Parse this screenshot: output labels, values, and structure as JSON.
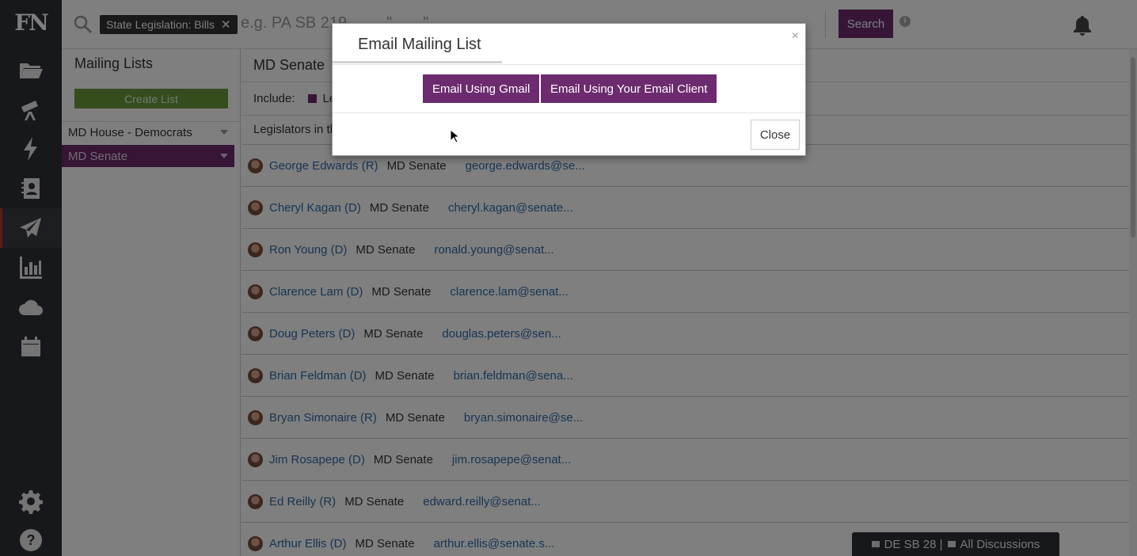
{
  "app": {
    "logo": "FN"
  },
  "rail": {
    "icons": [
      "folder-icon",
      "telescope-icon",
      "lightning-icon",
      "contacts-icon",
      "send-icon",
      "chart-icon",
      "cloud-icon",
      "calendar-icon",
      "gear-icon",
      "help-icon"
    ],
    "active": "send-icon"
  },
  "topbar": {
    "filter_chip": "State Legislation: Bills",
    "search_placeholder": "e.g. PA SB 219 ... ... \"... ...\"",
    "search_button": "Search"
  },
  "lists": {
    "title": "Mailing Lists",
    "create_button": "Create List",
    "items": [
      {
        "label": "MD House - Democrats",
        "selected": false
      },
      {
        "label": "MD Senate",
        "selected": true
      }
    ]
  },
  "main": {
    "header": "MD Senate",
    "include_label": "Include:",
    "include_option": "Le",
    "legislators_label": "Legislators in th",
    "rows": [
      {
        "name": "George Edwards (R)",
        "chamber": "MD Senate",
        "email": "george.edwards@se..."
      },
      {
        "name": "Cheryl Kagan (D)",
        "chamber": "MD Senate",
        "email": "cheryl.kagan@senate..."
      },
      {
        "name": "Ron Young (D)",
        "chamber": "MD Senate",
        "email": "ronald.young@senat..."
      },
      {
        "name": "Clarence Lam (D)",
        "chamber": "MD Senate",
        "email": "clarence.lam@senat..."
      },
      {
        "name": "Doug Peters (D)",
        "chamber": "MD Senate",
        "email": "douglas.peters@sen..."
      },
      {
        "name": "Brian Feldman (D)",
        "chamber": "MD Senate",
        "email": "brian.feldman@sena..."
      },
      {
        "name": "Bryan Simonaire (R)",
        "chamber": "MD Senate",
        "email": "bryan.simonaire@se..."
      },
      {
        "name": "Jim Rosapepe (D)",
        "chamber": "MD Senate",
        "email": "jim.rosapepe@senat..."
      },
      {
        "name": "Ed Reilly (R)",
        "chamber": "MD Senate",
        "email": "edward.reilly@senat..."
      },
      {
        "name": "Arthur Ellis (D)",
        "chamber": "MD Senate",
        "email": "arthur.ellis@senate.s..."
      }
    ]
  },
  "discussions": {
    "bill": "DE SB 28 |",
    "all": "All Discussions"
  },
  "modal": {
    "title": "Email Mailing List",
    "close_x": "×",
    "gmail_button": "Email Using Gmail",
    "client_button": "Email Using Your Email Client",
    "close_button": "Close"
  },
  "colors": {
    "primary": "#6c2a6f",
    "create": "#6a9a3a",
    "rail": "#2d3137",
    "link": "#2d6aa5"
  }
}
